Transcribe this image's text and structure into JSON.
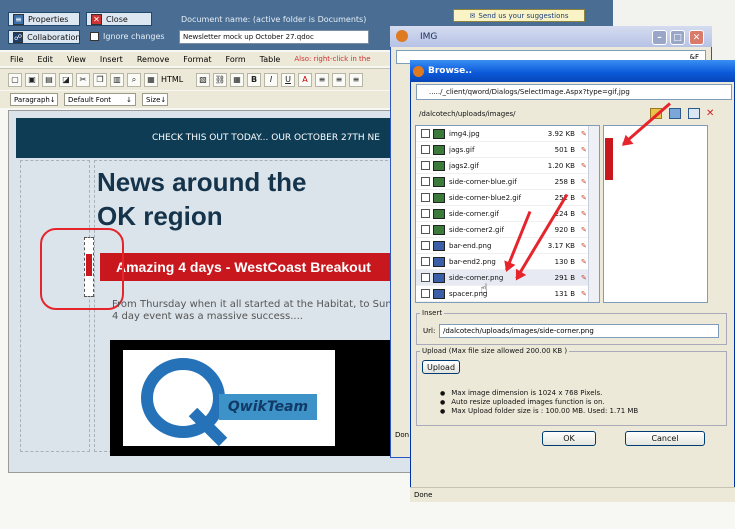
{
  "editor": {
    "properties_label": "Properties",
    "collaboration_label": "Collaboration",
    "close_label": "Close",
    "ignore_changes_label": "Ignore changes",
    "doc_name_label": "Document name: (active folder is Documents)",
    "doc_name_value": "Newsletter mock up October 27.qdoc",
    "suggest_label": "Send us your suggestions",
    "menu": [
      "File",
      "Edit",
      "View",
      "Insert",
      "Remove",
      "Format",
      "Form",
      "Table"
    ],
    "menu_hint": "Also: right-click in the",
    "html_label": "HTML",
    "paragraph": "Paragraph",
    "font": "Default Font",
    "size": "Size"
  },
  "document": {
    "banner": "CHECK THIS OUT TODAY... OUR OCTOBER 27TH NE",
    "headline_1": "News around the",
    "headline_2": "OK region",
    "red_bar": "Amazing 4 days - WestCoast Breakout",
    "body_1": "From Thursday when it all started at the Habitat, to Sunday's ca",
    "body_2": "4 day event was a massive success....",
    "logo_text": "QwikTeam"
  },
  "img_window": {
    "title": "IMG",
    "url_tail": "&F"
  },
  "browse": {
    "title": "Browse..",
    "url": "...../_client/qword/Dialogs/SelectImage.Aspx?type=gif,jpg",
    "path": "/dalcotech/uploads/images/",
    "files": [
      {
        "name": "img4.jpg",
        "size": "3.92 KB",
        "type": "jpg"
      },
      {
        "name": "jags.gif",
        "size": "501 B",
        "type": "gif"
      },
      {
        "name": "jags2.gif",
        "size": "1.20 KB",
        "type": "gif"
      },
      {
        "name": "side-corner-blue.gif",
        "size": "258 B",
        "type": "gif"
      },
      {
        "name": "side-corner-blue2.gif",
        "size": "252 B",
        "type": "gif"
      },
      {
        "name": "side-corner.gif",
        "size": "224 B",
        "type": "gif"
      },
      {
        "name": "side-corner2.gif",
        "size": "920 B",
        "type": "gif"
      },
      {
        "name": "bar-end.png",
        "size": "3.17 KB",
        "type": "png"
      },
      {
        "name": "bar-end2.png",
        "size": "130 B",
        "type": "png"
      },
      {
        "name": "side-corner.png",
        "size": "291 B",
        "type": "png"
      },
      {
        "name": "spacer.png",
        "size": "131 B",
        "type": "png"
      }
    ],
    "insert_label": "Insert",
    "url_label": "Url:",
    "url_value": "/dalcotech/uploads/images/side-corner.png",
    "upload_label": "Upload (Max file size allowed 200.00 KB )",
    "upload_button": "Upload",
    "notes": [
      "Max image dimension is 1024 x 768 Pixels.",
      "Auto resize uploaded images function is on.",
      "Max Upload folder size is : 100.00 MB. Used: 1.71 MB"
    ],
    "ok": "OK",
    "cancel": "Cancel",
    "status": "Done",
    "behind_done": "Don"
  },
  "colors": {
    "accent_red": "#e5242c",
    "header_blue": "#4a6e93",
    "xp_title": "#0a58d8"
  }
}
